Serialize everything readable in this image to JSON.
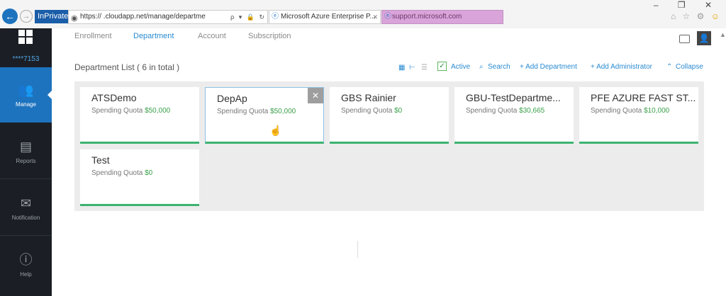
{
  "browser": {
    "back": "←",
    "forward": "⟳",
    "inprivate_label": "InPrivate",
    "url": "https://                 .cloudapp.net/manage/departme",
    "url_icons": "ρ ▾ 🔒 ↻",
    "tabs": [
      {
        "label": "Microsoft Azure Enterprise P..."
      },
      {
        "label": "support.microsoft.com"
      }
    ],
    "window_controls": "– ❐ ✕"
  },
  "sidebar": {
    "account_id": "****7153",
    "items": [
      {
        "label": "Manage",
        "icon": "users-icon",
        "active": true
      },
      {
        "label": "Reports",
        "icon": "report-icon",
        "active": false
      },
      {
        "label": "Notification",
        "icon": "mail-icon",
        "active": false
      },
      {
        "label": "Help",
        "icon": "help-icon",
        "active": false
      }
    ]
  },
  "topnav": {
    "tabs": [
      {
        "label": "Enrollment",
        "active": false
      },
      {
        "label": "Department",
        "active": true
      },
      {
        "label": "Account",
        "active": false
      },
      {
        "label": "Subscription",
        "active": false
      }
    ]
  },
  "list": {
    "title": "Department List ( 6 in total )",
    "toolbar": {
      "active_label": "Active",
      "search_label": "Search",
      "add_department_label": "+ Add Department",
      "add_admin_label": "+ Add Administrator",
      "collapse_label": "Collapse"
    }
  },
  "departments": [
    {
      "name": "ATSDemo",
      "quota_label": "Spending Quota",
      "quota": "$50,000"
    },
    {
      "name": "DepAp",
      "quota_label": "Spending Quota",
      "quota": "$50,000"
    },
    {
      "name": "GBS Rainier",
      "quota_label": "Spending Quota",
      "quota": "$0"
    },
    {
      "name": "GBU-TestDepartme...",
      "quota_label": "Spending Quota",
      "quota": "$30,665"
    },
    {
      "name": "PFE AZURE FAST ST...",
      "quota_label": "Spending Quota",
      "quota": "$10,000"
    },
    {
      "name": "Test",
      "quota_label": "Spending Quota",
      "quota": "$0"
    }
  ],
  "colors": {
    "accent": "#1e73be",
    "link": "#2a8bd2",
    "quota_green": "#3aa04a",
    "card_bar": "#3cb371",
    "sidebar_bg": "#1b1f25"
  }
}
